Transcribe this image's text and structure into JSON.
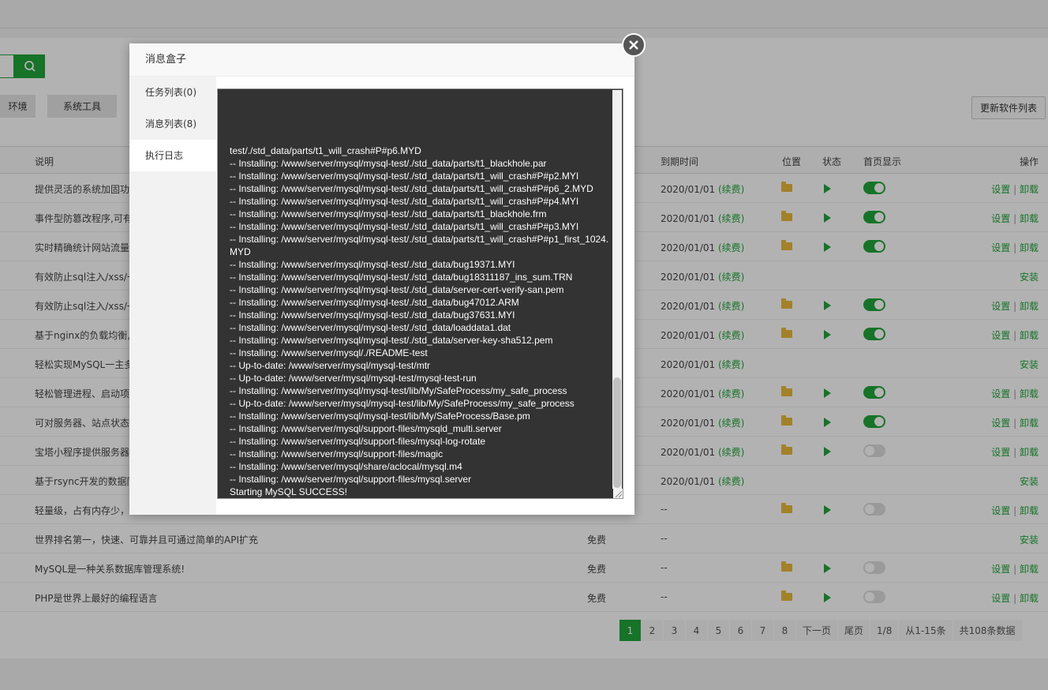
{
  "background": {
    "category_buttons": [
      "环境",
      "系统工具"
    ],
    "refresh_button": "更新软件列表",
    "columns": {
      "desc": "说明",
      "expire": "到期时间",
      "location": "位置",
      "status": "状态",
      "home_show": "首页显示",
      "ops": "操作"
    },
    "rows": [
      {
        "desc": "提供灵活的系统加固功",
        "price": "",
        "expire": "2020/01/01",
        "renew": "(续费)",
        "folder": true,
        "play": true,
        "toggle": "on",
        "ops": "settings"
      },
      {
        "desc": "事件型防篡改程序,可有",
        "price": "",
        "expire": "2020/01/01",
        "renew": "(续费)",
        "folder": true,
        "play": true,
        "toggle": "on",
        "ops": "settings"
      },
      {
        "desc": "实时精确统计网站流量",
        "price": "",
        "expire": "2020/01/01",
        "renew": "(续费)",
        "folder": true,
        "play": true,
        "toggle": "on",
        "ops": "settings"
      },
      {
        "desc": "有效防止sql注入/xss/一",
        "price": "",
        "expire": "2020/01/01",
        "renew": "(续费)",
        "folder": false,
        "play": false,
        "toggle": "none",
        "ops": "install"
      },
      {
        "desc": "有效防止sql注入/xss/一",
        "price": "",
        "expire": "2020/01/01",
        "renew": "(续费)",
        "folder": true,
        "play": true,
        "toggle": "on",
        "ops": "settings"
      },
      {
        "desc": "基于nginx的负载均衡,",
        "price": "",
        "expire": "2020/01/01",
        "renew": "(续费)",
        "folder": true,
        "play": true,
        "toggle": "on",
        "ops": "settings"
      },
      {
        "desc": "轻松实现MySQL一主多",
        "price": "",
        "expire": "2020/01/01",
        "renew": "(续费)",
        "folder": false,
        "play": false,
        "toggle": "none",
        "ops": "install"
      },
      {
        "desc": "轻松管理进程、启动项",
        "price": "",
        "expire": "2020/01/01",
        "renew": "(续费)",
        "folder": true,
        "play": true,
        "toggle": "on",
        "ops": "settings"
      },
      {
        "desc": "可对服务器、站点状态",
        "price": "",
        "expire": "2020/01/01",
        "renew": "(续费)",
        "folder": true,
        "play": true,
        "toggle": "on",
        "ops": "settings"
      },
      {
        "desc": "宝塔小程序提供服务器",
        "price": "",
        "expire": "2020/01/01",
        "renew": "(续费)",
        "folder": true,
        "play": true,
        "toggle": "off",
        "ops": "settings"
      },
      {
        "desc": "基于rsync开发的数据同",
        "price": "",
        "expire": "2020/01/01",
        "renew": "(续费)",
        "folder": false,
        "play": false,
        "toggle": "none",
        "ops": "install"
      },
      {
        "desc": "轻量级，占有内存少，",
        "price": "",
        "expire": "--",
        "renew": "",
        "folder": true,
        "play": true,
        "toggle": "off",
        "ops": "settings"
      },
      {
        "desc": "世界排名第一，快速、可靠并且可通过简单的API扩充",
        "price": "免费",
        "expire": "--",
        "renew": "",
        "folder": false,
        "play": false,
        "toggle": "none",
        "ops": "install"
      },
      {
        "desc": "MySQL是一种关系数据库管理系统!",
        "price": "免费",
        "expire": "--",
        "renew": "",
        "folder": true,
        "play": true,
        "toggle": "off",
        "ops": "settings"
      },
      {
        "desc": "PHP是世界上最好的编程语言",
        "price": "免费",
        "expire": "--",
        "renew": "",
        "folder": true,
        "play": true,
        "toggle": "off",
        "ops": "settings"
      }
    ],
    "ops_labels": {
      "settings": "设置",
      "uninstall": "卸载",
      "install": "安装",
      "sep": "|"
    },
    "pager": [
      "1",
      "2",
      "3",
      "4",
      "5",
      "6",
      "7",
      "8",
      "下一页",
      "尾页",
      "1/8",
      "从1-15条",
      "共108条数据"
    ],
    "pager_active": 0
  },
  "modal": {
    "title": "消息盒子",
    "tabs": [
      "任务列表(0)",
      "消息列表(8)",
      "执行日志"
    ],
    "active_tab": 2,
    "log": "test/./std_data/parts/t1_will_crash#P#p6.MYD\n-- Installing: /www/server/mysql/mysql-test/./std_data/parts/t1_blackhole.par\n-- Installing: /www/server/mysql/mysql-test/./std_data/parts/t1_will_crash#P#p2.MYI\n-- Installing: /www/server/mysql/mysql-test/./std_data/parts/t1_will_crash#P#p6_2.MYD\n-- Installing: /www/server/mysql/mysql-test/./std_data/parts/t1_will_crash#P#p4.MYI\n-- Installing: /www/server/mysql/mysql-test/./std_data/parts/t1_blackhole.frm\n-- Installing: /www/server/mysql/mysql-test/./std_data/parts/t1_will_crash#P#p3.MYI\n-- Installing: /www/server/mysql/mysql-test/./std_data/parts/t1_will_crash#P#p1_first_1024.MYD\n-- Installing: /www/server/mysql/mysql-test/./std_data/bug19371.MYI\n-- Installing: /www/server/mysql/mysql-test/./std_data/bug18311187_ins_sum.TRN\n-- Installing: /www/server/mysql/mysql-test/./std_data/server-cert-verify-san.pem\n-- Installing: /www/server/mysql/mysql-test/./std_data/bug47012.ARM\n-- Installing: /www/server/mysql/mysql-test/./std_data/bug37631.MYI\n-- Installing: /www/server/mysql/mysql-test/./std_data/loaddata1.dat\n-- Installing: /www/server/mysql/mysql-test/./std_data/server-key-sha512.pem\n-- Installing: /www/server/mysql/./README-test\n-- Up-to-date: /www/server/mysql/mysql-test/mtr\n-- Up-to-date: /www/server/mysql/mysql-test/mysql-test-run\n-- Installing: /www/server/mysql/mysql-test/lib/My/SafeProcess/my_safe_process\n-- Up-to-date: /www/server/mysql/mysql-test/lib/My/SafeProcess/my_safe_process\n-- Installing: /www/server/mysql/mysql-test/lib/My/SafeProcess/Base.pm\n-- Installing: /www/server/mysql/support-files/mysqld_multi.server\n-- Installing: /www/server/mysql/support-files/mysql-log-rotate\n-- Installing: /www/server/mysql/support-files/magic\n-- Installing: /www/server/mysql/share/aclocal/mysql.m4\n-- Installing: /www/server/mysql/support-files/mysql.server\nStarting MySQL SUCCESS!",
    "icons": {
      "close": "close-icon",
      "search": "search-icon"
    }
  }
}
